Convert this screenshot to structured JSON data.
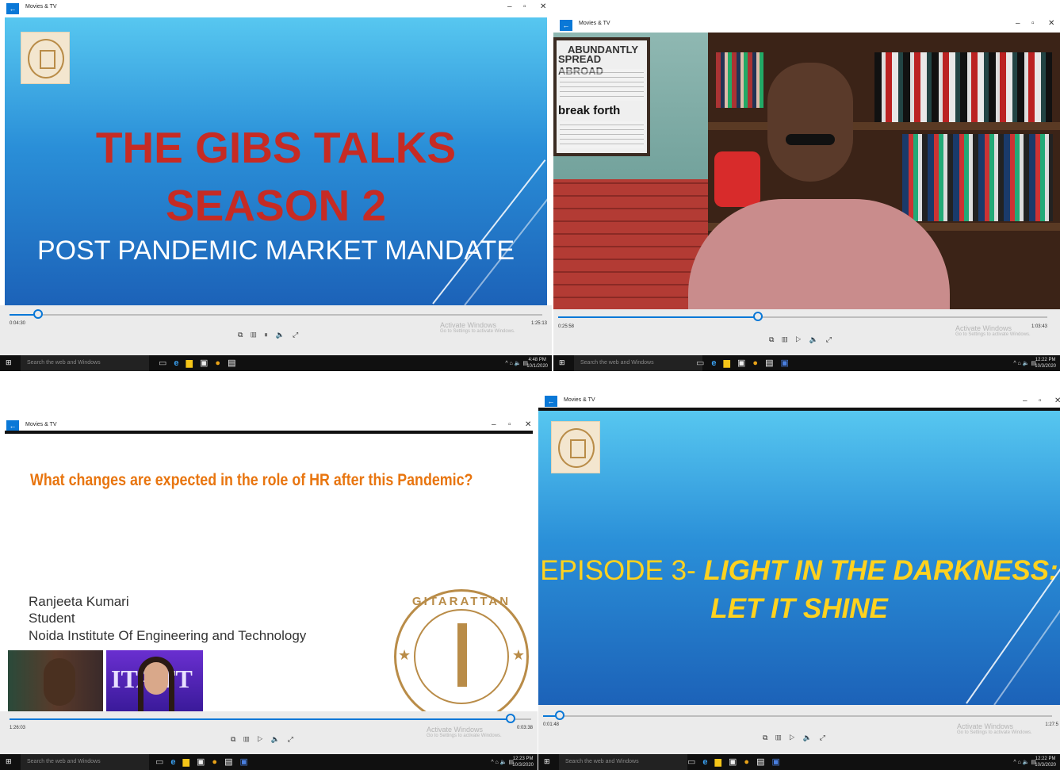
{
  "app": {
    "title": "Movies & TV"
  },
  "search_placeholder": "Search the web and Windows",
  "activate": {
    "line1": "Activate Windows",
    "line2": "Go to Settings to activate Windows."
  },
  "panes": [
    {
      "slide": {
        "line1": "THE GIBS TALKS",
        "line2": "SEASON 2",
        "line3": "POST PANDEMIC MARKET MANDATE"
      },
      "player": {
        "elapsed": "0:04:30",
        "duration": "1:25:13",
        "progress": 0.053,
        "state": "playing"
      },
      "clock": {
        "time": "4:48 PM",
        "date": "10/1/2020"
      }
    },
    {
      "poster": {
        "line1": "ABUNDANTLY",
        "line2": "SPREAD ABROAD",
        "line3": "break forth"
      },
      "player": {
        "elapsed": "0:25:58",
        "duration": "1:03:43",
        "progress": 0.408,
        "state": "paused"
      },
      "clock": {
        "time": "12:22 PM",
        "date": "10/3/2020"
      }
    },
    {
      "slide": {
        "question": "What changes are expected in the role of HR after this Pandemic?",
        "name": "Ranjeeta Kumari",
        "role": "Student",
        "institution": "Noida Institute Of Engineering and Technology",
        "seal_text": "GITARATTAN"
      },
      "player": {
        "elapsed": "1:26:03",
        "duration": "0:03:38",
        "progress": 0.96,
        "state": "paused"
      },
      "clock": {
        "time": "12:23 PM",
        "date": "10/3/2020"
      }
    },
    {
      "slide": {
        "prefix": "EPISODE 3- ",
        "line1": "LIGHT IN THE DARKNESS:",
        "line2": "LET IT SHINE"
      },
      "player": {
        "elapsed": "0:01:48",
        "duration": "1:27:5",
        "progress": 0.033,
        "state": "paused"
      },
      "clock": {
        "time": "12:22 PM",
        "date": "10/3/2020"
      }
    }
  ],
  "icons": {
    "back": "back-arrow-icon",
    "minimize": "minimize-icon",
    "restore": "restore-icon",
    "close": "close-icon",
    "cast": "cast-icon",
    "miniview": "mini-view-icon",
    "playpause": "play-pause-icon",
    "volume": "volume-icon",
    "fullscreen": "fullscreen-icon"
  },
  "colors": {
    "accent": "#0a78d7",
    "title_red": "#c62b24",
    "question_orange": "#e8750f",
    "episode_yellow": "#ffd21f"
  }
}
